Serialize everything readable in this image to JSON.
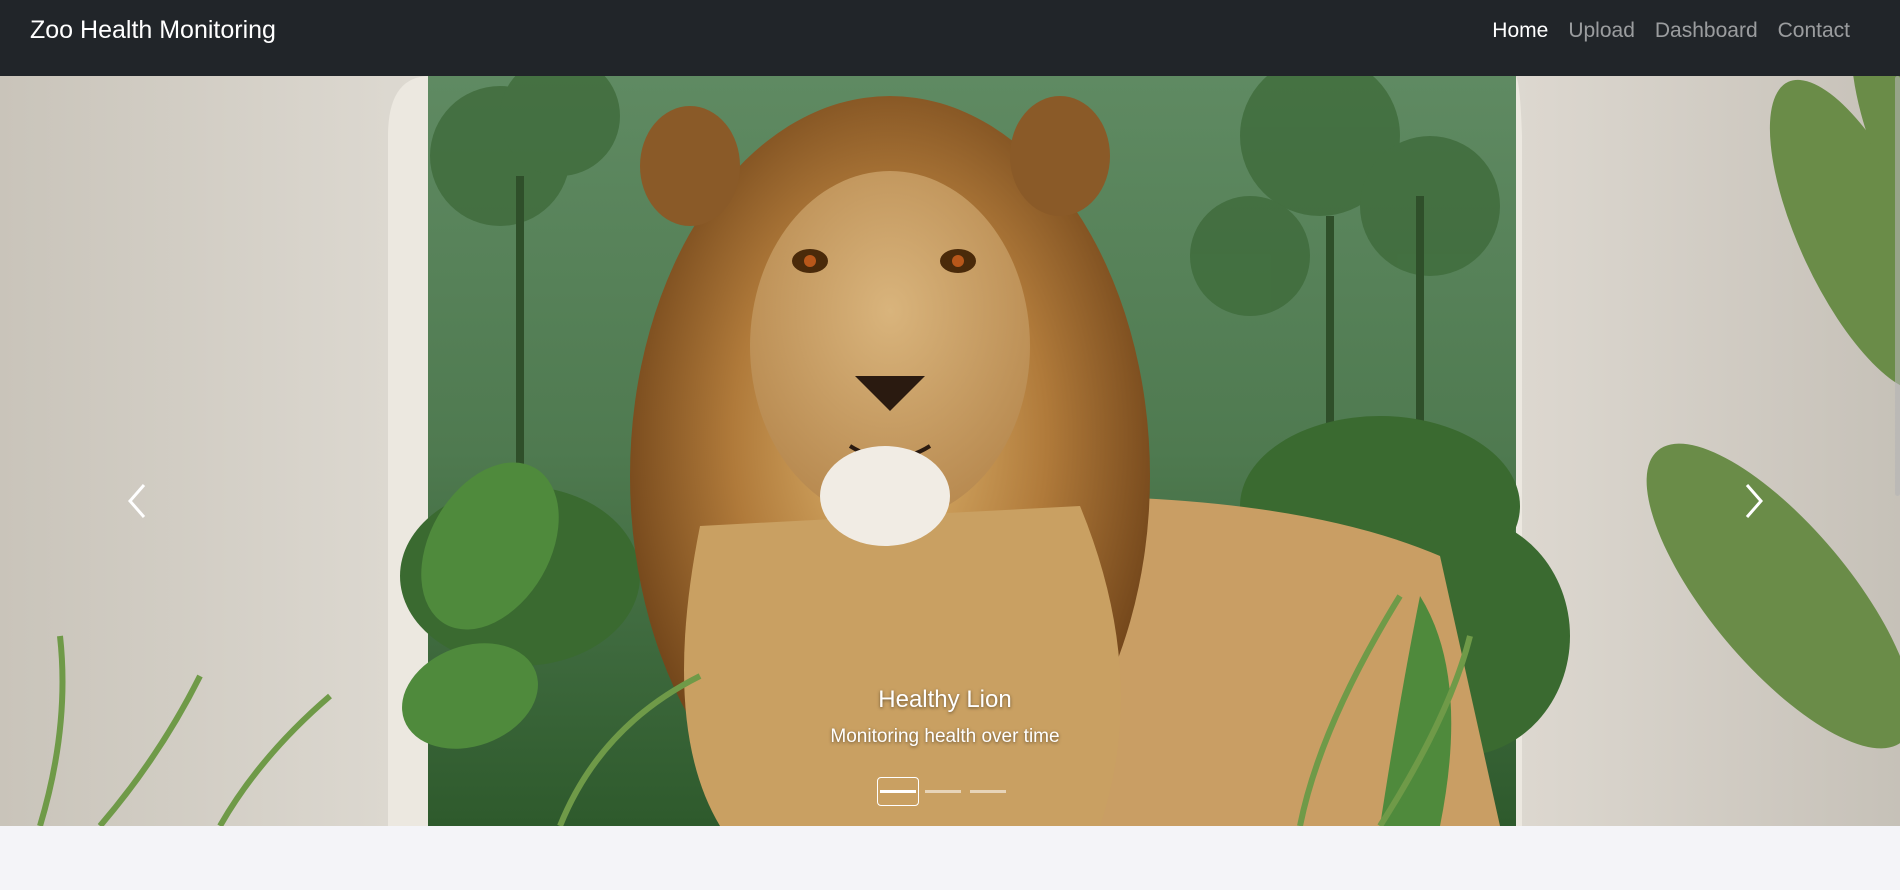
{
  "navbar": {
    "brand": "Zoo Health Monitoring",
    "links": [
      {
        "label": "Home",
        "active": true
      },
      {
        "label": "Upload",
        "active": false
      },
      {
        "label": "Dashboard",
        "active": false
      },
      {
        "label": "Contact",
        "active": false
      }
    ]
  },
  "carousel": {
    "active_slide": 1,
    "slide_count": 3,
    "caption": {
      "title": "Healthy Lion",
      "text": "Monitoring health over time"
    },
    "controls": {
      "prev_icon": "chevron-left-icon",
      "next_icon": "chevron-right-icon"
    }
  },
  "colors": {
    "navbar_bg": "#212529",
    "page_bg": "#f4f4f8",
    "nav_active": "#ffffff",
    "nav_inactive": "#8c8f93"
  }
}
